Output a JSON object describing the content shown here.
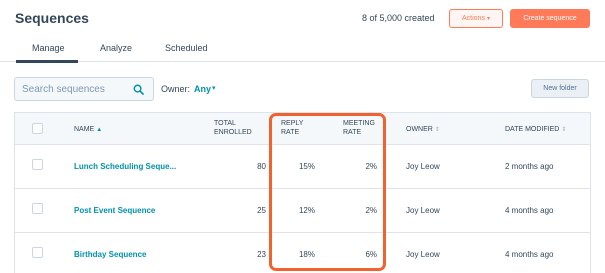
{
  "header": {
    "title": "Sequences",
    "created_count": "8 of 5,000 created",
    "actions_label": "Actions",
    "create_label": "Create sequence"
  },
  "tabs": [
    {
      "label": "Manage",
      "active": true
    },
    {
      "label": "Analyze",
      "active": false
    },
    {
      "label": "Scheduled",
      "active": false
    }
  ],
  "toolbar": {
    "search_placeholder": "Search sequences",
    "owner_label": "Owner:",
    "owner_value": "Any",
    "new_folder_label": "New folder"
  },
  "table": {
    "columns": {
      "name": "NAME",
      "total_enrolled_1": "TOTAL",
      "total_enrolled_2": "ENROLLED",
      "reply_rate_1": "REPLY",
      "reply_rate_2": "RATE",
      "meeting_rate_1": "MEETING",
      "meeting_rate_2": "RATE",
      "owner": "OWNER",
      "date_modified": "DATE MODIFIED"
    },
    "rows": [
      {
        "name": "Lunch Scheduling Seque...",
        "enrolled": "80",
        "reply": "15%",
        "meeting": "2%",
        "owner": "Joy Leow",
        "modified": "2 months ago"
      },
      {
        "name": "Post Event Sequence",
        "enrolled": "25",
        "reply": "12%",
        "meeting": "2%",
        "owner": "Joy Leow",
        "modified": "4 months ago"
      },
      {
        "name": "Birthday Sequence",
        "enrolled": "23",
        "reply": "18%",
        "meeting": "6%",
        "owner": "Joy Leow",
        "modified": "4 months ago"
      }
    ]
  },
  "colors": {
    "accent": "#ff7a59",
    "link": "#0091ae",
    "highlight": "#f2622e"
  }
}
